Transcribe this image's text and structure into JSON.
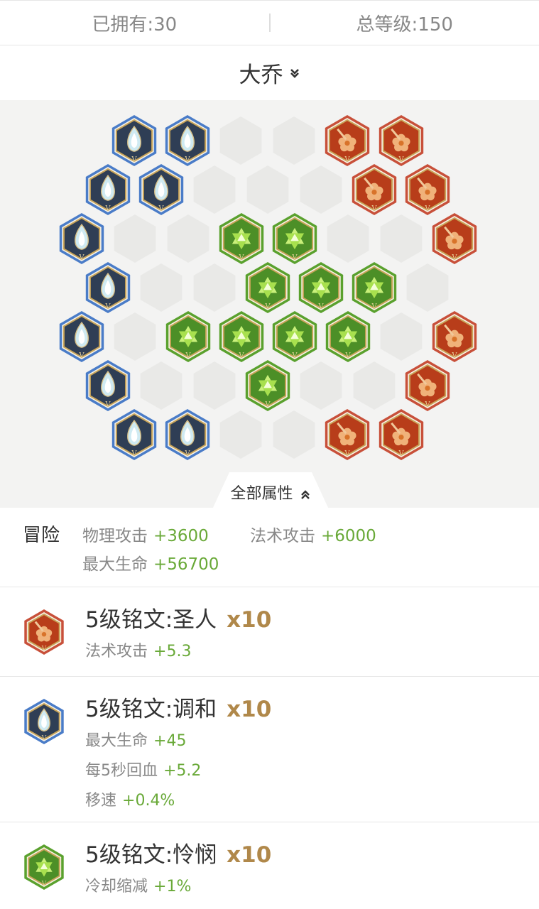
{
  "stats": {
    "owned": "已拥有:30",
    "total_level": "总等级:150"
  },
  "hero": {
    "name": "大乔"
  },
  "board": {
    "colors": {
      "blue": "#4a7cc8",
      "red": "#c8503a",
      "green": "#5aa12e",
      "empty": "#e9e9e7"
    },
    "rune_icons": {
      "blue": "teardrop-rune-icon",
      "red": "flower-rune-icon",
      "green": "star-rune-icon"
    }
  },
  "tab": {
    "label": "全部属性"
  },
  "summary": {
    "category": "冒险",
    "items": [
      {
        "label": "物理攻击",
        "value": "+3600"
      },
      {
        "label": "法术攻击",
        "value": "+6000"
      },
      {
        "label": "最大生命",
        "value": "+56700"
      }
    ]
  },
  "runes": [
    {
      "title": "5级铭文:圣人",
      "count": "x10",
      "icon": "red-flower-rune-icon",
      "attrs": [
        {
          "label": "法术攻击",
          "value": "+5.3"
        }
      ]
    },
    {
      "title": "5级铭文:调和",
      "count": "x10",
      "icon": "blue-teardrop-rune-icon",
      "attrs": [
        {
          "label": "最大生命",
          "value": "+45"
        },
        {
          "label": "每5秒回血",
          "value": "+5.2"
        },
        {
          "label": "移速",
          "value": "+0.4%"
        }
      ]
    },
    {
      "title": "5级铭文:怜悯",
      "count": "x10",
      "icon": "green-star-rune-icon",
      "attrs": [
        {
          "label": "冷却缩减",
          "value": "+1%"
        }
      ]
    }
  ]
}
